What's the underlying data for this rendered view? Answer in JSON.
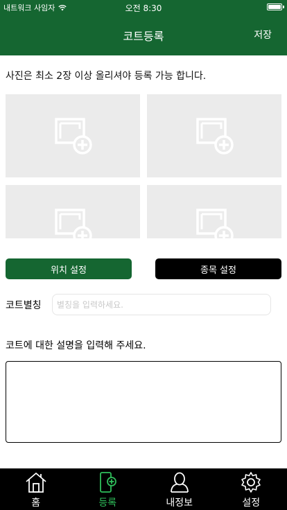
{
  "status_bar": {
    "carrier": "내트워크 사임자",
    "time": "오전 8:30"
  },
  "nav": {
    "title": "코트등록",
    "save_label": "저장"
  },
  "notice": "사진은 최소 2장 이상 올리셔야 등록 가능 합니다.",
  "buttons": {
    "location": "위치 설정",
    "sport": "종목 설정"
  },
  "nickname": {
    "label": "코트별칭",
    "placeholder": "별칭을 입력하세요.",
    "value": ""
  },
  "description": {
    "label": "코트에 대한 설명을 입력해 주세요.",
    "value": ""
  },
  "tabs": [
    {
      "label": "홈",
      "icon": "home-icon",
      "active": false
    },
    {
      "label": "등록",
      "icon": "register-icon",
      "active": true
    },
    {
      "label": "내정보",
      "icon": "profile-icon",
      "active": false
    },
    {
      "label": "설정",
      "icon": "settings-icon",
      "active": false
    }
  ],
  "colors": {
    "primary": "#156631",
    "active_tab": "#2fbf5b",
    "tab_bar": "#000000",
    "photo_slot": "#ebebeb"
  }
}
